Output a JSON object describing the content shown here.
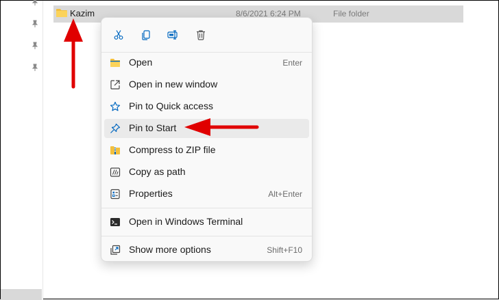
{
  "file": {
    "name": "Kazim",
    "date_modified": "8/6/2021 6:24 PM",
    "type": "File folder"
  },
  "toolbar": {
    "cut_icon": "scissors-icon",
    "copy_icon": "copy-icon",
    "rename_icon": "rename-icon",
    "delete_icon": "trash-icon"
  },
  "menu": {
    "items": [
      {
        "label": "Open",
        "shortcut": "Enter",
        "icon": "folder-icon"
      },
      {
        "label": "Open in new window",
        "shortcut": "",
        "icon": "new-window-icon"
      },
      {
        "label": "Pin to Quick access",
        "shortcut": "",
        "icon": "star-icon"
      },
      {
        "label": "Pin to Start",
        "shortcut": "",
        "icon": "pin-icon",
        "highlighted": true
      },
      {
        "label": "Compress to ZIP file",
        "shortcut": "",
        "icon": "zip-icon"
      },
      {
        "label": "Copy as path",
        "shortcut": "",
        "icon": "path-icon"
      },
      {
        "label": "Properties",
        "shortcut": "Alt+Enter",
        "icon": "properties-icon"
      },
      {
        "label": "Open in Windows Terminal",
        "shortcut": "",
        "icon": "terminal-icon"
      },
      {
        "label": "Show more options",
        "shortcut": "Shift+F10",
        "icon": "more-options-icon"
      }
    ]
  },
  "colors": {
    "accent": "#0067c0",
    "annotation_arrow": "#e00000",
    "selection": "#d9d9d9"
  }
}
